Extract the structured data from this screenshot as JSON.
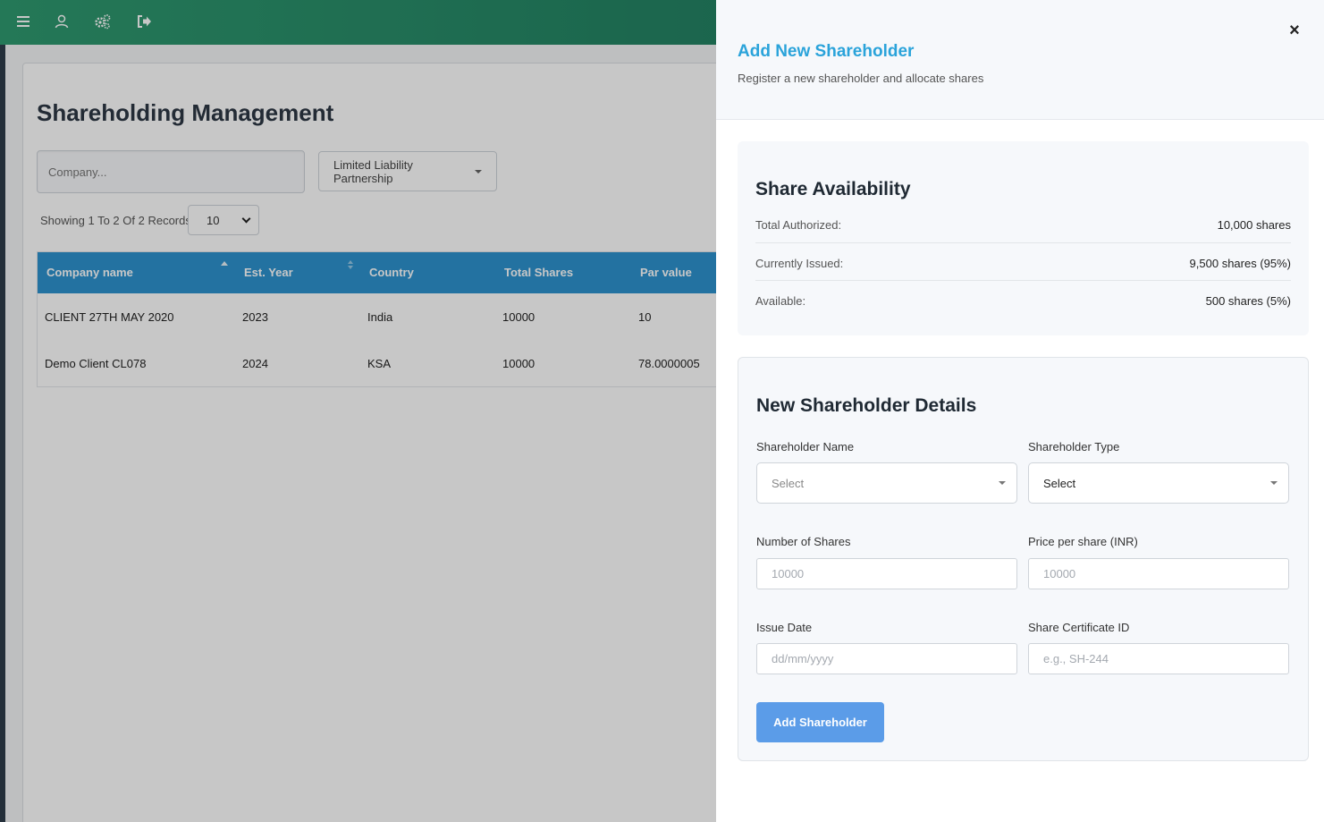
{
  "topbar": {
    "icons": [
      "menu-icon",
      "user-icon",
      "settings-icon",
      "logout-icon"
    ]
  },
  "main": {
    "title": "Shareholding Management",
    "company_placeholder": "Company...",
    "company_type": "Limited Liability Partnership",
    "records_text": "Showing 1 To 2 Of 2 Records",
    "per_page": "10",
    "table": {
      "headers": [
        "Company name",
        "Est. Year",
        "Country",
        "Total Shares",
        "Par value"
      ],
      "rows": [
        [
          "CLIENT 27TH MAY 2020",
          "2023",
          "India",
          "10000",
          "10"
        ],
        [
          "Demo Client CL078",
          "2024",
          "KSA",
          "10000",
          "78.0000005"
        ]
      ]
    }
  },
  "panel": {
    "title": "Add New Shareholder",
    "subtitle": "Register a new shareholder and allocate shares",
    "close_symbol": "×",
    "availability": {
      "title": "Share Availability",
      "rows": [
        {
          "label": "Total Authorized:",
          "value": "10,000 shares"
        },
        {
          "label": "Currently Issued:",
          "value": "9,500 shares (95%)"
        },
        {
          "label": "Available:",
          "value": "500 shares (5%)"
        }
      ]
    },
    "form": {
      "title": "New Shareholder Details",
      "shareholder_name_label": "Shareholder Name",
      "shareholder_name_value": "Select",
      "shareholder_type_label": "Shareholder Type",
      "shareholder_type_value": "Select",
      "num_shares_label": "Number of Shares",
      "num_shares_placeholder": "10000",
      "price_label": "Price per share (INR)",
      "price_placeholder": "10000",
      "issue_date_label": "Issue Date",
      "issue_date_placeholder": "dd/mm/yyyy",
      "cert_label": "Share Certificate ID",
      "cert_placeholder": "e.g., SH-244",
      "submit_label": "Add Shareholder"
    }
  },
  "colors": {
    "topbar": "#238263",
    "table_header": "#2e93cf",
    "panel_title": "#2aa3da",
    "submit_button": "#5b9ce8"
  }
}
